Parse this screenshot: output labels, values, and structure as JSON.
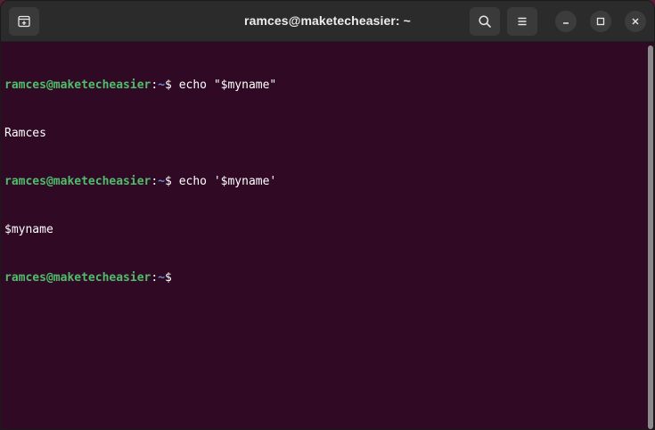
{
  "window": {
    "title": "ramces@maketecheasier: ~"
  },
  "icons": {
    "new_tab": "new-tab-icon",
    "search": "search-icon",
    "menu": "hamburger-menu-icon",
    "minimize": "minimize-icon",
    "maximize": "maximize-icon",
    "close": "close-icon"
  },
  "terminal": {
    "lines": [
      {
        "user": "ramces@maketecheasier",
        "colon": ":",
        "path": "~",
        "prompt": "$ ",
        "command": "echo \"$myname\""
      },
      {
        "output": "Ramces"
      },
      {
        "user": "ramces@maketecheasier",
        "colon": ":",
        "path": "~",
        "prompt": "$ ",
        "command": "echo '$myname'"
      },
      {
        "output": "$myname"
      },
      {
        "user": "ramces@maketecheasier",
        "colon": ":",
        "path": "~",
        "prompt": "$",
        "command": ""
      }
    ]
  },
  "colors": {
    "terminal_bg": "#300a24",
    "user_host": "#4fbd6c",
    "path": "#5f8fd6",
    "titlebar_bg": "#2b2b2b"
  }
}
